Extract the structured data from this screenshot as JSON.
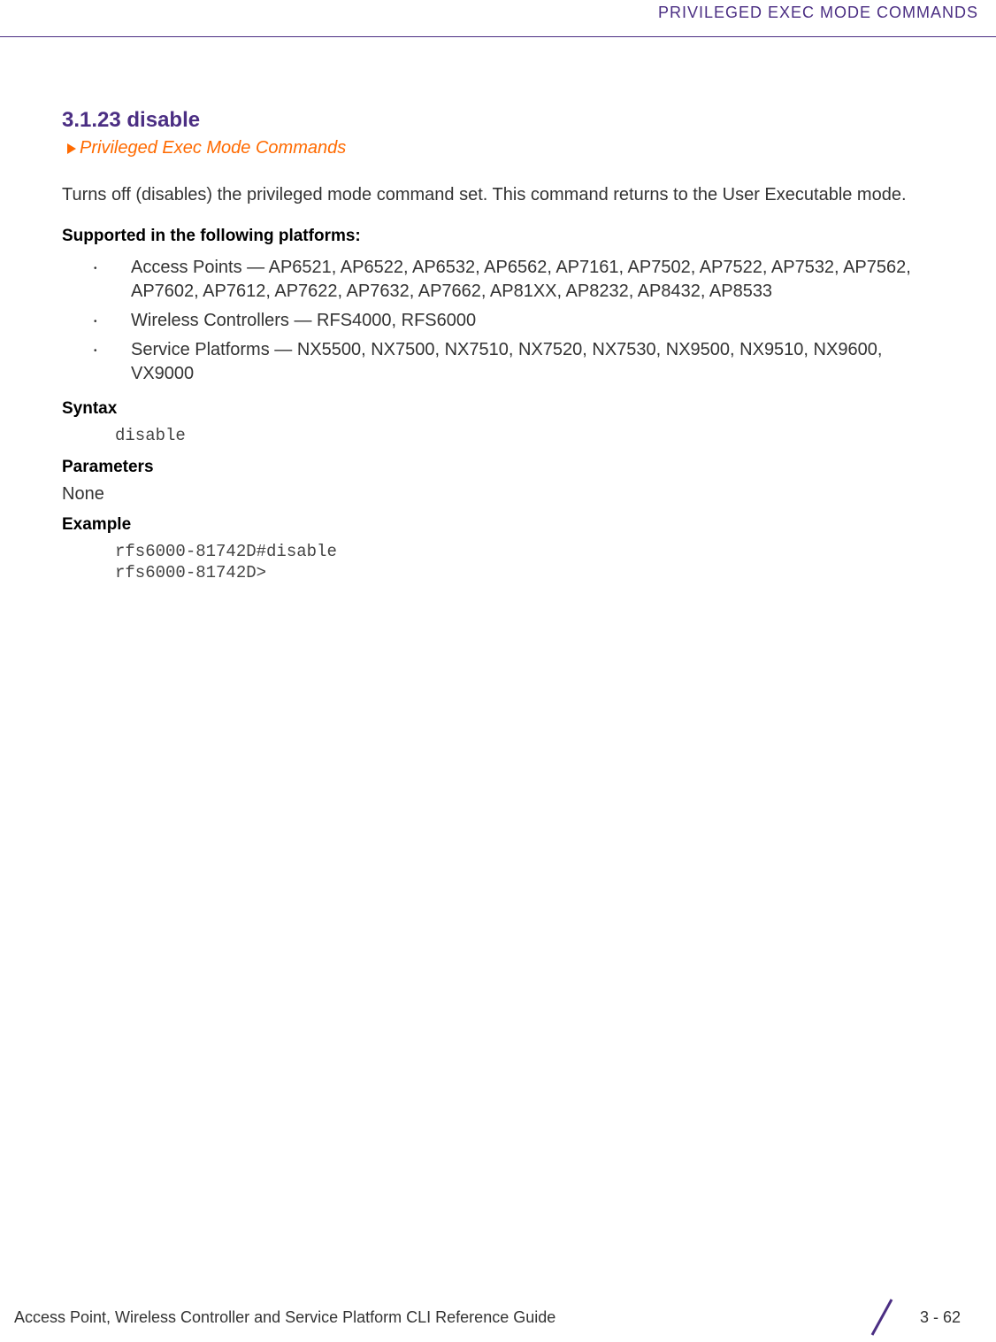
{
  "header": {
    "title": "PRIVILEGED EXEC MODE COMMANDS"
  },
  "section": {
    "title": "3.1.23 disable",
    "breadcrumb": "Privileged Exec Mode Commands",
    "intro": "Turns off (disables) the privileged mode command set. This command returns to the User Executable mode.",
    "supported_heading": "Supported in the following platforms:",
    "bullets": [
      "Access Points — AP6521, AP6522, AP6532, AP6562, AP7161, AP7502, AP7522, AP7532, AP7562, AP7602, AP7612, AP7622, AP7632, AP7662, AP81XX, AP8232, AP8432, AP8533",
      "Wireless Controllers — RFS4000, RFS6000",
      "Service Platforms — NX5500, NX7500, NX7510, NX7520, NX7530, NX9500, NX9510, NX9600, VX9000"
    ],
    "syntax_heading": "Syntax",
    "syntax_code": "disable",
    "parameters_heading": "Parameters",
    "parameters_value": "None",
    "example_heading": "Example",
    "example_code": "rfs6000-81742D#disable\nrfs6000-81742D>"
  },
  "footer": {
    "guide": "Access Point, Wireless Controller and Service Platform CLI Reference Guide",
    "page": "3 - 62"
  }
}
